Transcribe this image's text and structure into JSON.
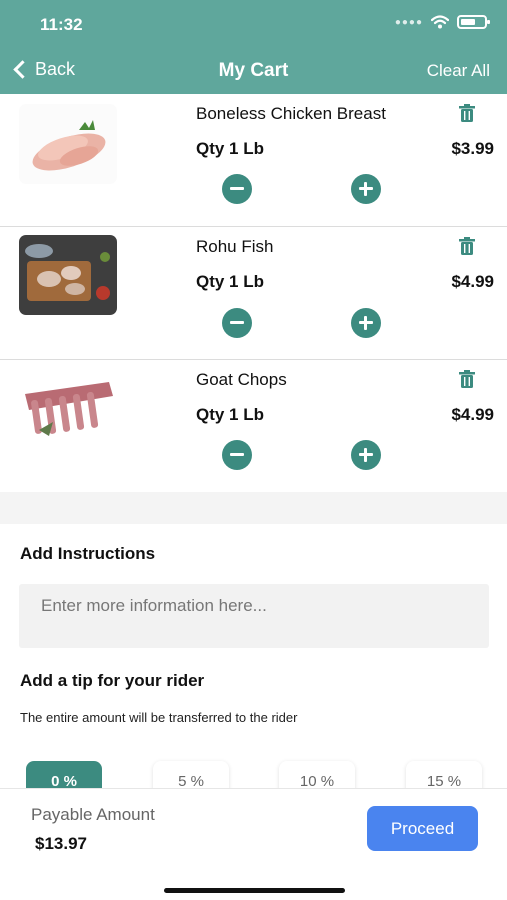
{
  "status_bar": {
    "time": "11:32",
    "signal_icon": "signal-dots-icon",
    "wifi_icon": "wifi-icon",
    "battery_icon": "battery-icon"
  },
  "header": {
    "back_label": "Back",
    "title": "My Cart",
    "clear_label": "Clear All",
    "color": "#5fa79c"
  },
  "cart": {
    "items": [
      {
        "name": "Boneless Chicken Breast",
        "qty": "Qty 1 Lb",
        "price": "$3.99",
        "image": "chicken-breast-image"
      },
      {
        "name": "Rohu Fish",
        "qty": "Qty 1 Lb",
        "price": "$4.99",
        "image": "rohu-fish-image"
      },
      {
        "name": "Goat Chops",
        "qty": "Qty 1 Lb",
        "price": "$4.99",
        "image": "goat-chops-image"
      }
    ]
  },
  "instructions": {
    "title": "Add Instructions",
    "placeholder": "Enter more information here..."
  },
  "tip": {
    "title": "Add a tip for your rider",
    "note": "The entire amount will be transferred to the rider",
    "options": [
      "0 %",
      "5 %",
      "10 %",
      "15 %"
    ],
    "selected": "0 %"
  },
  "footer": {
    "payable_label": "Payable Amount",
    "payable_amount": "$13.97",
    "proceed_label": "Proceed"
  },
  "colors": {
    "accent": "#3c8b80",
    "header": "#5fa79c",
    "proceed": "#4a84ef"
  }
}
